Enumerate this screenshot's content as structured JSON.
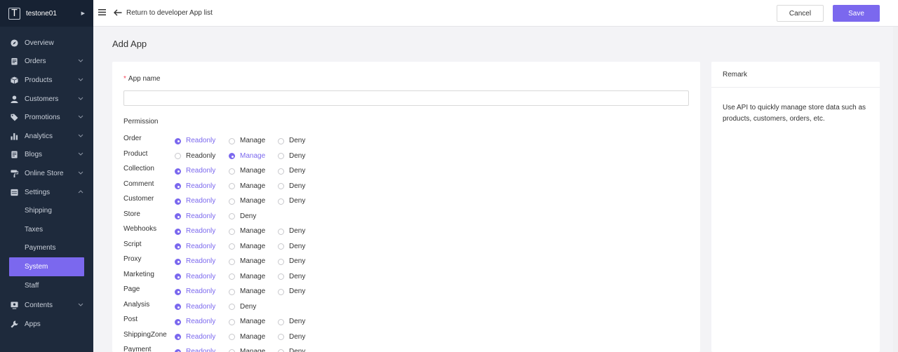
{
  "store": {
    "logo_letter": "T",
    "name": "testone01"
  },
  "sidebar": {
    "items": [
      {
        "label": "Overview",
        "icon": "compass-icon",
        "chevron": false
      },
      {
        "label": "Orders",
        "icon": "clipboard-icon",
        "chevron": true
      },
      {
        "label": "Products",
        "icon": "box-icon",
        "chevron": true
      },
      {
        "label": "Customers",
        "icon": "user-icon",
        "chevron": true
      },
      {
        "label": "Promotions",
        "icon": "tag-icon",
        "chevron": true
      },
      {
        "label": "Analytics",
        "icon": "bar-chart-icon",
        "chevron": true
      },
      {
        "label": "Blogs",
        "icon": "document-icon",
        "chevron": true
      },
      {
        "label": "Online Store",
        "icon": "paint-roller-icon",
        "chevron": true
      },
      {
        "label": "Settings",
        "icon": "settings-icon",
        "chevron": true,
        "expanded": true
      }
    ],
    "settings_sub": [
      "Shipping",
      "Taxes",
      "Payments",
      "System",
      "Staff"
    ],
    "active_sub": "System",
    "bottom_items": [
      {
        "label": "Contents",
        "icon": "monitor-icon",
        "chevron": true
      },
      {
        "label": "Apps",
        "icon": "wrench-icon",
        "chevron": false
      }
    ]
  },
  "topbar": {
    "back_text": "Return to developer App list",
    "cancel_label": "Cancel",
    "save_label": "Save"
  },
  "page": {
    "title": "Add App",
    "app_name_label": "App name",
    "app_name_value": "",
    "permission_title": "Permission"
  },
  "permissions": [
    {
      "name": "Order",
      "options": [
        "Readonly",
        "Manage",
        "Deny"
      ],
      "selected": "Readonly"
    },
    {
      "name": "Product",
      "options": [
        "Readonly",
        "Manage",
        "Deny"
      ],
      "selected": "Manage"
    },
    {
      "name": "Collection",
      "options": [
        "Readonly",
        "Manage",
        "Deny"
      ],
      "selected": "Readonly"
    },
    {
      "name": "Comment",
      "options": [
        "Readonly",
        "Manage",
        "Deny"
      ],
      "selected": "Readonly"
    },
    {
      "name": "Customer",
      "options": [
        "Readonly",
        "Manage",
        "Deny"
      ],
      "selected": "Readonly"
    },
    {
      "name": "Store",
      "options": [
        "Readonly",
        "Deny"
      ],
      "selected": "Readonly"
    },
    {
      "name": "Webhooks",
      "options": [
        "Readonly",
        "Manage",
        "Deny"
      ],
      "selected": "Readonly"
    },
    {
      "name": "Script",
      "options": [
        "Readonly",
        "Manage",
        "Deny"
      ],
      "selected": "Readonly"
    },
    {
      "name": "Proxy",
      "options": [
        "Readonly",
        "Manage",
        "Deny"
      ],
      "selected": "Readonly"
    },
    {
      "name": "Marketing",
      "options": [
        "Readonly",
        "Manage",
        "Deny"
      ],
      "selected": "Readonly"
    },
    {
      "name": "Page",
      "options": [
        "Readonly",
        "Manage",
        "Deny"
      ],
      "selected": "Readonly"
    },
    {
      "name": "Analysis",
      "options": [
        "Readonly",
        "Deny"
      ],
      "selected": "Readonly"
    },
    {
      "name": "Post",
      "options": [
        "Readonly",
        "Manage",
        "Deny"
      ],
      "selected": "Readonly"
    },
    {
      "name": "ShippingZone",
      "options": [
        "Readonly",
        "Manage",
        "Deny"
      ],
      "selected": "Readonly"
    },
    {
      "name": "Payment",
      "options": [
        "Readonly",
        "Manage",
        "Deny"
      ],
      "selected": "Readonly"
    }
  ],
  "remark": {
    "title": "Remark",
    "text": "Use API to quickly manage store data such as products, customers, orders, etc."
  },
  "colors": {
    "accent": "#7b68ee",
    "sidebar_bg": "#1e2a3c",
    "required": "#f5475b"
  }
}
